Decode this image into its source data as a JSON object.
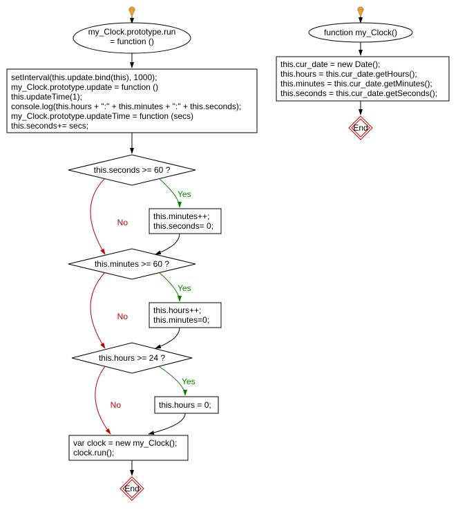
{
  "left": {
    "start": "my_Clock.prototype.run\n= function ()",
    "process1": [
      "setInterval(this.update.bind(this), 1000);",
      "my_Clock.prototype.update = function ()",
      "this.updateTime(1);",
      "console.log(this.hours + \":\" + this.minutes + \":\" + this.seconds);",
      "my_Clock.prototype.updateTime = function (secs)",
      "this.seconds+= secs;"
    ],
    "decision1": "this.seconds >= 60 ?",
    "action1": [
      "this.minutes++;",
      "this.seconds= 0;"
    ],
    "decision2": "this.minutes >= 60 ?",
    "action2": [
      "this.hours++;",
      "this.minutes=0;"
    ],
    "decision3": "this.hours >= 24 ?",
    "action3": "this.hours = 0;",
    "final": [
      "var clock = new my_Clock();",
      "clock.run();"
    ],
    "end": "End"
  },
  "right": {
    "start": "function my_Clock()",
    "process": [
      "this.cur_date = new Date();",
      "this.hours = this.cur_date.getHours();",
      "this.minutes = this.cur_date.getMinutes();",
      "this.seconds = this.cur_date.getSeconds();"
    ],
    "end": "End"
  },
  "labels": {
    "yes": "Yes",
    "no": "No"
  }
}
